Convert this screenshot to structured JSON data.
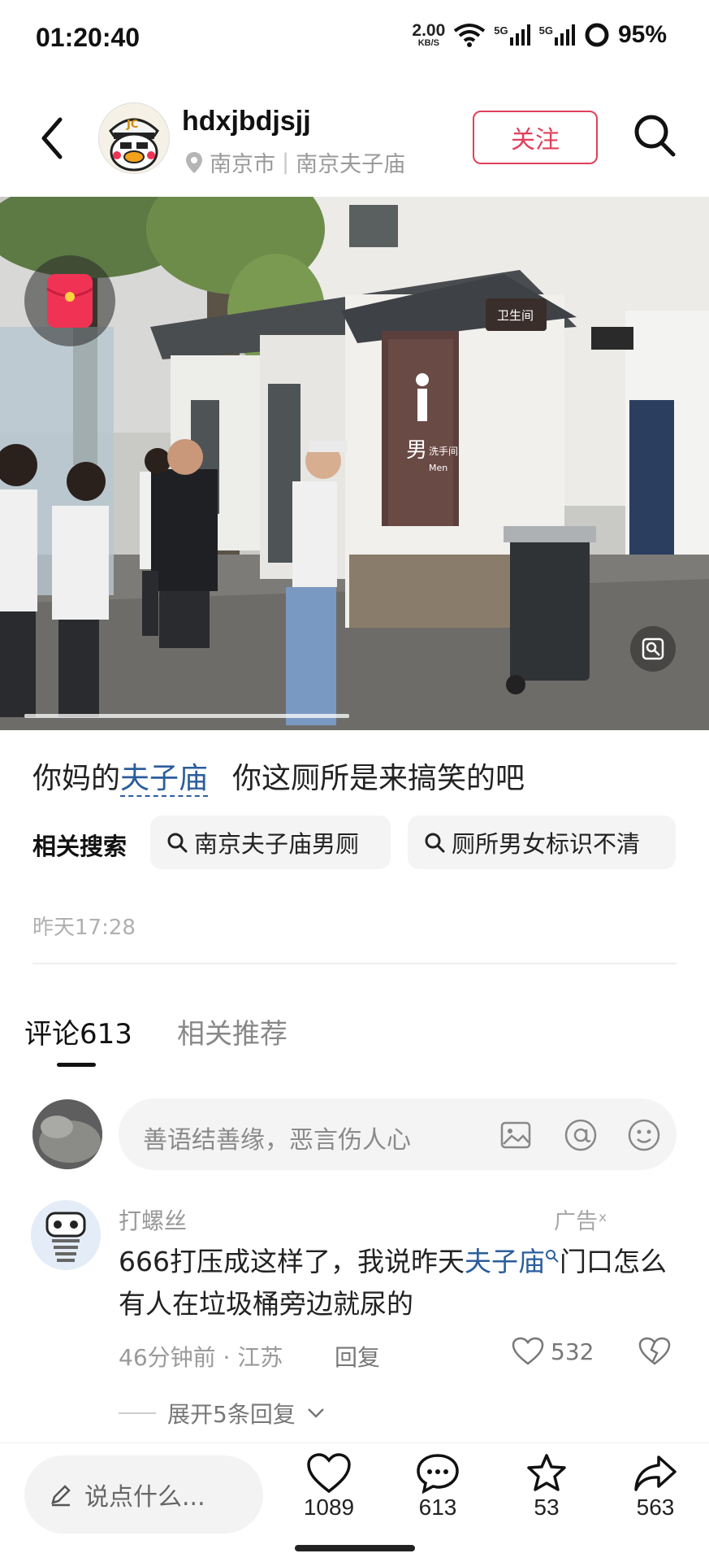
{
  "status_bar": {
    "time": "01:20:40",
    "net_speed_value": "2.00",
    "net_speed_unit": "KB/S",
    "signal1": "5G",
    "signal2": "5G",
    "battery": "95%"
  },
  "header": {
    "username": "hdxjbdjsjj",
    "location_city": "南京市",
    "location_place": "南京夫子庙",
    "follow_label": "关注"
  },
  "post": {
    "caption_pre": "你妈的",
    "caption_link": "夫子庙",
    "caption_post": "你这厕所是来搞笑的吧",
    "related_label": "相关搜索",
    "related_searches": [
      "南京夫子庙男厕",
      "厕所男女标识不清"
    ],
    "time": "昨天17:28"
  },
  "tabs": {
    "comments": "评论613",
    "related": "相关推荐"
  },
  "comment_input": {
    "placeholder": "善语结善缘，恶言伤人心"
  },
  "comment": {
    "author": "打螺丝",
    "ad_label": "广告ˣ",
    "text_pre": "666打压成这样了，我说昨天",
    "text_link": "夫子庙",
    "text_post": "门口怎么有人在垃圾桶旁边就尿的",
    "time_location": "46分钟前 · 江苏",
    "reply_label": "回复",
    "likes": "532",
    "expand_label": "展开5条回复"
  },
  "photo_signs": {
    "restroom": "卫生间",
    "men": "男",
    "wash": "洗手间",
    "men_en": "Men"
  },
  "bottom_bar": {
    "say_placeholder": "说点什么...",
    "likes": "1089",
    "comments": "613",
    "favorites": "53",
    "shares": "563"
  },
  "colors": {
    "accent": "#e0405b",
    "link": "#2b5e9c"
  }
}
